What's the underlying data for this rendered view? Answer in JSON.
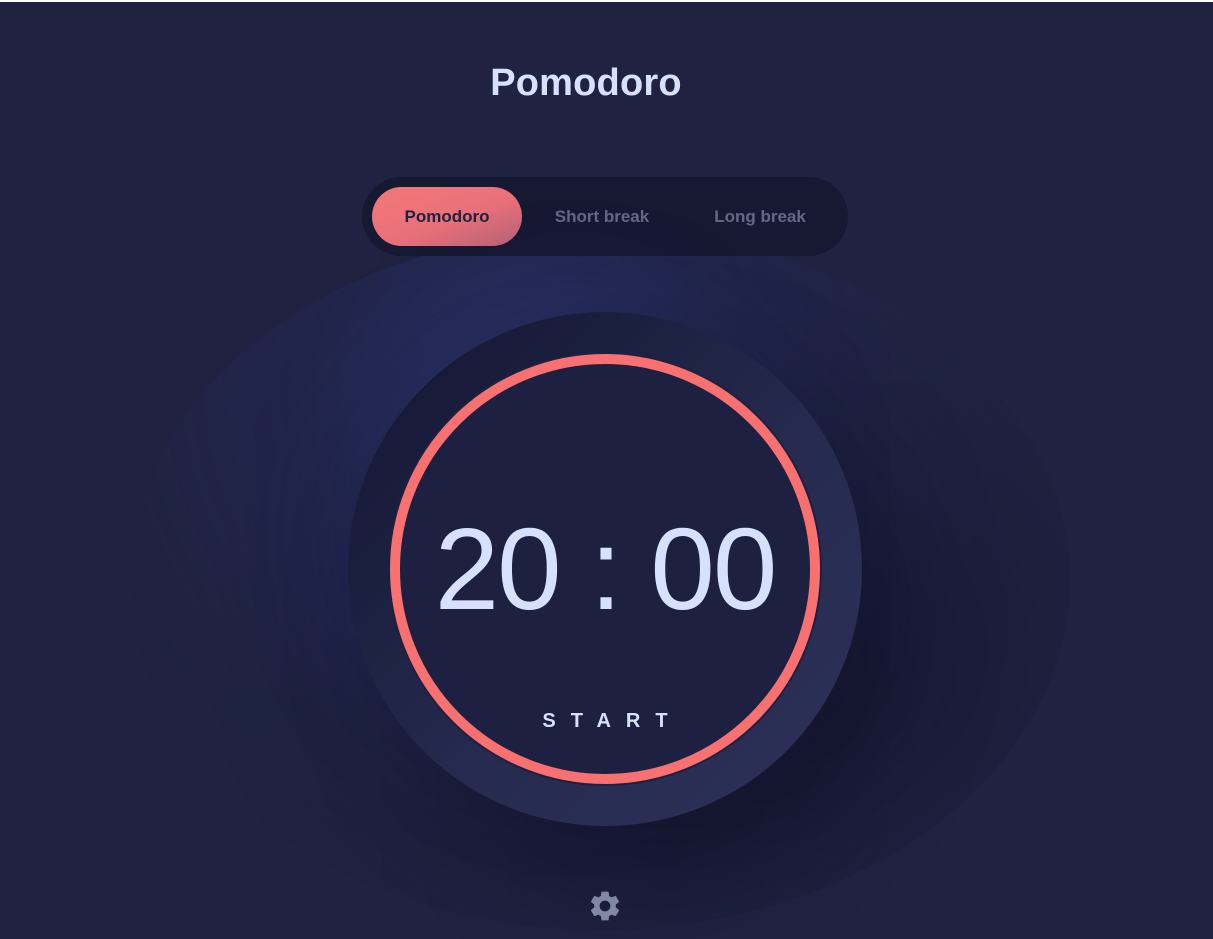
{
  "app": {
    "title": "Pomodoro"
  },
  "modes": [
    {
      "label": "Pomodoro",
      "active": true
    },
    {
      "label": "Short break",
      "active": false
    },
    {
      "label": "Long break",
      "active": false
    }
  ],
  "timer": {
    "time": "20 : 00",
    "action_label": "START",
    "progress": 1.0
  },
  "settings": {
    "icon": "gear-icon"
  },
  "colors": {
    "background": "#1f2241",
    "accent": "#f87070",
    "text": "#d7e0fe",
    "muted_text": "#636985",
    "dark_panel": "#161932"
  }
}
